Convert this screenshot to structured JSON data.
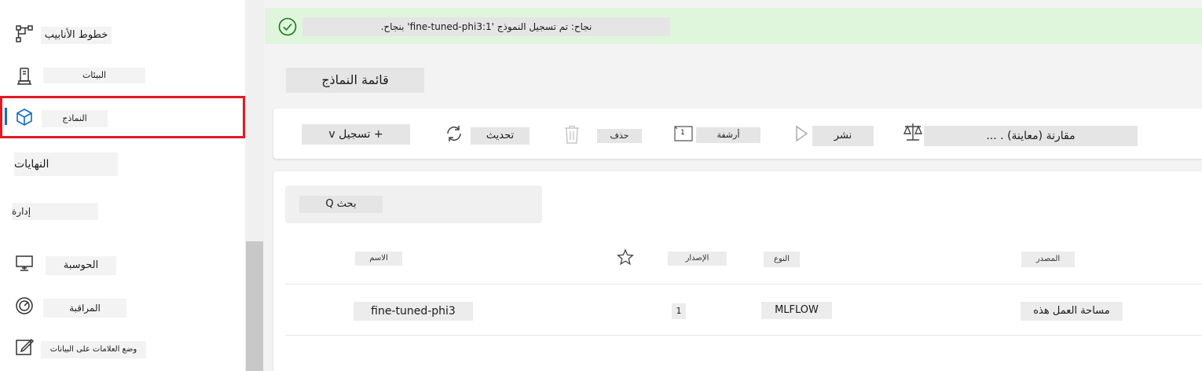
{
  "sidebar": {
    "items": [
      {
        "label": "خطوط الأنابيب",
        "icon": "pipelines-icon"
      },
      {
        "label": "البيئات",
        "icon": "environments-icon"
      },
      {
        "label": "النماذج",
        "icon": "models-cube-icon",
        "selected": true
      },
      {
        "label": "النهايات"
      },
      {
        "label": "إدارة"
      },
      {
        "label": "الحوسبة",
        "icon": "compute-monitor-icon"
      },
      {
        "label": "المراقبة",
        "icon": "monitoring-gauge-icon"
      },
      {
        "label": "وضع العلامات على البيانات",
        "icon": "data-labeling-edit-icon"
      }
    ]
  },
  "banner": {
    "text": "نجاح: تم تسجيل النموذج 'fine-tuned-phi3:1' بنجاح.",
    "icon": "success-check-icon",
    "color": "#dff6dd"
  },
  "page": {
    "title": "قائمة النماذج"
  },
  "toolbar": {
    "register_label": "+ تسجيل v",
    "refresh_label": "تحديث",
    "delete_label": "حذف",
    "archive_label": "أرشفة",
    "archive_icon_number": "1",
    "deploy_label": "نشر",
    "compare_label": "مقارنة (معاينة) . ..."
  },
  "search": {
    "label": "بحث Q"
  },
  "table": {
    "headers": {
      "name": "الاسم",
      "version": "الإصدار",
      "type": "النوع",
      "source": "المصدر"
    },
    "rows": [
      {
        "name": "fine-tuned-phi3",
        "version": "1",
        "type": "MLFLOW",
        "source": "مساحة العمل هذه"
      }
    ]
  },
  "colors": {
    "accent": "#0f6cbd",
    "highlight": "#e01b24",
    "success": "#107c10"
  }
}
